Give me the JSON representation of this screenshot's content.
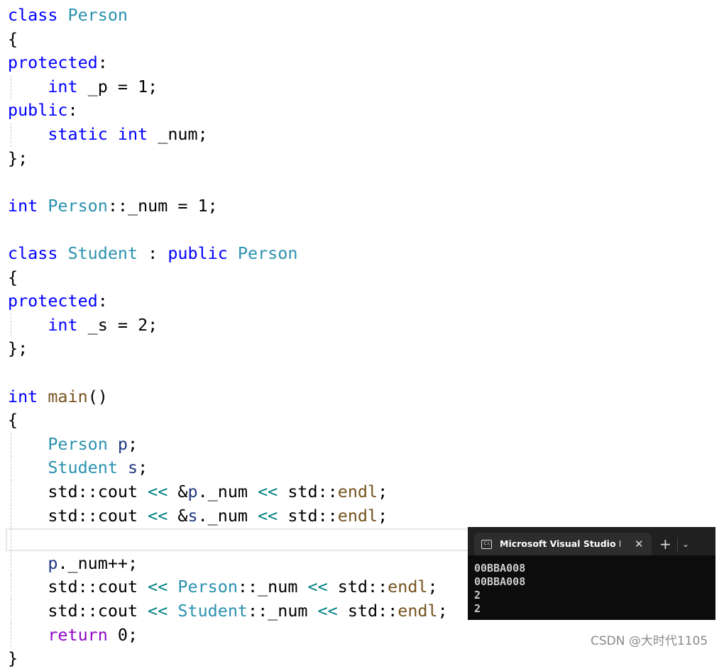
{
  "code_lines": [
    [
      [
        "class ",
        "kw"
      ],
      [
        "Person",
        "ty"
      ]
    ],
    [
      [
        "{",
        "pl"
      ]
    ],
    [
      [
        "protected",
        "kw"
      ],
      [
        ":",
        "pl"
      ]
    ],
    [
      [
        "    ",
        "pl"
      ],
      [
        "int",
        "kw"
      ],
      [
        " _p = 1;",
        "pl"
      ]
    ],
    [
      [
        "public",
        "kw"
      ],
      [
        ":",
        "pl"
      ]
    ],
    [
      [
        "    ",
        "pl"
      ],
      [
        "static ",
        "kw"
      ],
      [
        "int",
        "kw"
      ],
      [
        " _num;",
        "pl"
      ]
    ],
    [
      [
        "};",
        "pl"
      ]
    ],
    [],
    [
      [
        "int ",
        "kw"
      ],
      [
        "Person",
        "ty"
      ],
      [
        "::_num = 1;",
        "pl"
      ]
    ],
    [],
    [
      [
        "class ",
        "kw"
      ],
      [
        "Student",
        "ty"
      ],
      [
        " : ",
        "pl"
      ],
      [
        "public ",
        "kw"
      ],
      [
        "Person",
        "ty"
      ]
    ],
    [
      [
        "{",
        "pl"
      ]
    ],
    [
      [
        "protected",
        "kw"
      ],
      [
        ":",
        "pl"
      ]
    ],
    [
      [
        "    ",
        "pl"
      ],
      [
        "int",
        "kw"
      ],
      [
        " _s = 2;",
        "pl"
      ]
    ],
    [
      [
        "};",
        "pl"
      ]
    ],
    [],
    [
      [
        "int ",
        "kw"
      ],
      [
        "main",
        "fn"
      ],
      [
        "()",
        "pl"
      ]
    ],
    [
      [
        "{",
        "pl"
      ]
    ],
    [
      [
        "    ",
        "pl"
      ],
      [
        "Person ",
        "ty"
      ],
      [
        "p",
        "va"
      ],
      [
        ";",
        "pl"
      ]
    ],
    [
      [
        "    ",
        "pl"
      ],
      [
        "Student ",
        "ty"
      ],
      [
        "s",
        "va"
      ],
      [
        ";",
        "pl"
      ]
    ],
    [
      [
        "    std::cout ",
        "pl"
      ],
      [
        "<<",
        "op"
      ],
      [
        " &",
        "pl"
      ],
      [
        "p",
        "va"
      ],
      [
        "._num ",
        "pl"
      ],
      [
        "<<",
        "op"
      ],
      [
        " std::",
        "pl"
      ],
      [
        "endl",
        "fn"
      ],
      [
        ";",
        "pl"
      ]
    ],
    [
      [
        "    std::cout ",
        "pl"
      ],
      [
        "<<",
        "op"
      ],
      [
        " &",
        "pl"
      ],
      [
        "s",
        "va"
      ],
      [
        "._num ",
        "pl"
      ],
      [
        "<<",
        "op"
      ],
      [
        " std::",
        "pl"
      ],
      [
        "endl",
        "fn"
      ],
      [
        ";",
        "pl"
      ]
    ],
    [],
    [
      [
        "    ",
        "pl"
      ],
      [
        "p",
        "va"
      ],
      [
        "._num++;",
        "pl"
      ]
    ],
    [
      [
        "    std::cout ",
        "pl"
      ],
      [
        "<<",
        "op"
      ],
      [
        " ",
        "pl"
      ],
      [
        "Person",
        "ty"
      ],
      [
        "::_num ",
        "pl"
      ],
      [
        "<<",
        "op"
      ],
      [
        " std::",
        "pl"
      ],
      [
        "endl",
        "fn"
      ],
      [
        ";",
        "pl"
      ]
    ],
    [
      [
        "    std::cout ",
        "pl"
      ],
      [
        "<<",
        "op"
      ],
      [
        " ",
        "pl"
      ],
      [
        "Student",
        "ty"
      ],
      [
        "::_num ",
        "pl"
      ],
      [
        "<<",
        "op"
      ],
      [
        " std::",
        "pl"
      ],
      [
        "endl",
        "fn"
      ],
      [
        ";",
        "pl"
      ]
    ],
    [
      [
        "    ",
        "pl"
      ],
      [
        "return ",
        "ct"
      ],
      [
        "0;",
        "pl"
      ]
    ],
    [
      [
        "}",
        "pl"
      ]
    ]
  ],
  "guide_lines": [
    3,
    5,
    13,
    18,
    19,
    20,
    21,
    22,
    23,
    24,
    25,
    26
  ],
  "terminal": {
    "tab_title": "Microsoft Visual Studio Debug Console",
    "tab_icon": "console-icon",
    "close_glyph": "✕",
    "new_tab_glyph": "+",
    "dropdown_glyph": "⌄",
    "output": [
      "00BBA008",
      "00BBA008",
      "2",
      "2"
    ]
  },
  "watermark": "CSDN @大时代1105",
  "colors": {
    "keyword": "#0000ff",
    "type": "#2b91af",
    "function": "#74531f",
    "variable": "#1f377f",
    "operator": "#008080",
    "control": "#8f08c4",
    "terminal_bg": "#0c0c0c"
  }
}
